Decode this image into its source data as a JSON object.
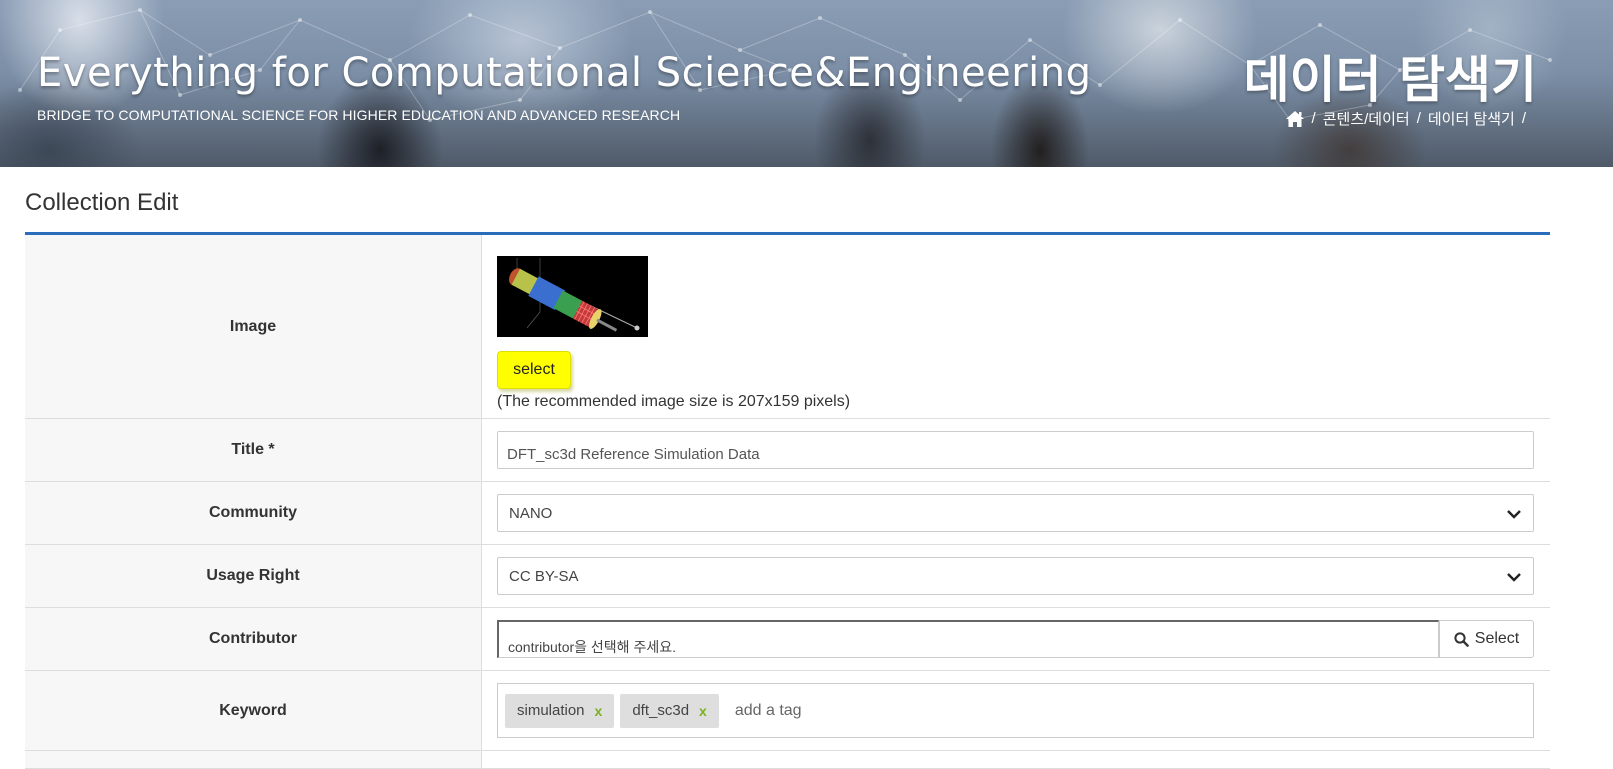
{
  "header": {
    "site_title": "Everything for Computational Science&Engineering",
    "site_subtitle": "BRIDGE TO COMPUTATIONAL SCIENCE FOR HIGHER EDUCATION AND ADVANCED RESEARCH",
    "page_heading": "데이터 탐색기",
    "breadcrumb": [
      {
        "icon": "home-icon"
      },
      {
        "label": "콘텐츠/데이터"
      },
      {
        "label": "데이터 탐색기"
      }
    ],
    "breadcrumb_separator": "/"
  },
  "form": {
    "section_title": "Collection Edit",
    "accent_color": "#2a6ebb",
    "image": {
      "label": "Image",
      "select_label": "select",
      "select_button_color": "#ffff00",
      "hint": "(The recommended image size is 207x159 pixels)"
    },
    "title": {
      "label": "Title *",
      "value": "DFT_sc3d Reference Simulation Data"
    },
    "community": {
      "label": "Community",
      "selected": "NANO"
    },
    "usage_right": {
      "label": "Usage Right",
      "selected": "CC BY-SA"
    },
    "contributor": {
      "label": "Contributor",
      "placeholder": "contributor을 선택해 주세요.",
      "button_label": "Select",
      "button_icon": "search-icon"
    },
    "keyword": {
      "label": "Keyword",
      "tags": [
        "simulation",
        "dft_sc3d"
      ],
      "remove_symbol": "x",
      "placeholder": "add a tag"
    }
  }
}
